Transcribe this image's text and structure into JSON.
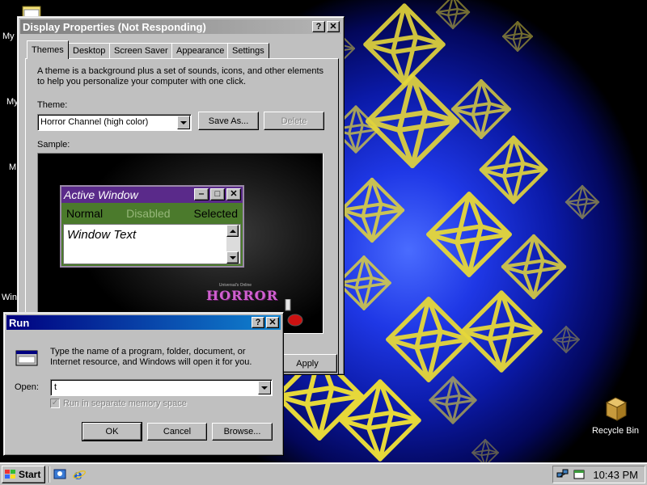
{
  "desktop": {
    "icon_labels": [
      "My",
      "My",
      "M",
      "Win"
    ],
    "recycle_bin": "Recycle Bin"
  },
  "display_props": {
    "title": "Display Properties (Not Responding)",
    "tabs": [
      "Themes",
      "Desktop",
      "Screen Saver",
      "Appearance",
      "Settings"
    ],
    "selected_tab": "Themes",
    "intro_text": "A theme is a background plus a set of sounds, icons, and other elements to help you personalize your computer with one click.",
    "theme_label": "Theme:",
    "theme_value": "Horror Channel (high color)",
    "save_as_button": "Save As...",
    "delete_button": "Delete",
    "sample_label": "Sample:",
    "apply_button": "Apply",
    "help_glyph": "?",
    "close_glyph": "✕"
  },
  "sample_window": {
    "title": "Active Window",
    "menu_items": [
      "Normal",
      "Disabled",
      "Selected"
    ],
    "window_text": "Window Text",
    "horror_logo": "HORROR",
    "horror_logo_small": "Universal's Online"
  },
  "run_dialog": {
    "title": "Run",
    "description": "Type the name of a program, folder, document, or Internet resource, and Windows will open it for you.",
    "open_label": "Open:",
    "open_value": "t",
    "separate_memory_label": "Run in separate memory space",
    "ok_button": "OK",
    "cancel_button": "Cancel",
    "browse_button": "Browse..."
  },
  "taskbar": {
    "start_label": "Start",
    "clock": "10:43 PM"
  },
  "colors": {
    "titlebar_active": "#000080",
    "titlebar_inactive": "#808080",
    "horror_purple": "#5a2a8a",
    "horror_green": "#4b7a2c",
    "octahedron_yellow": "#e6d83a"
  }
}
